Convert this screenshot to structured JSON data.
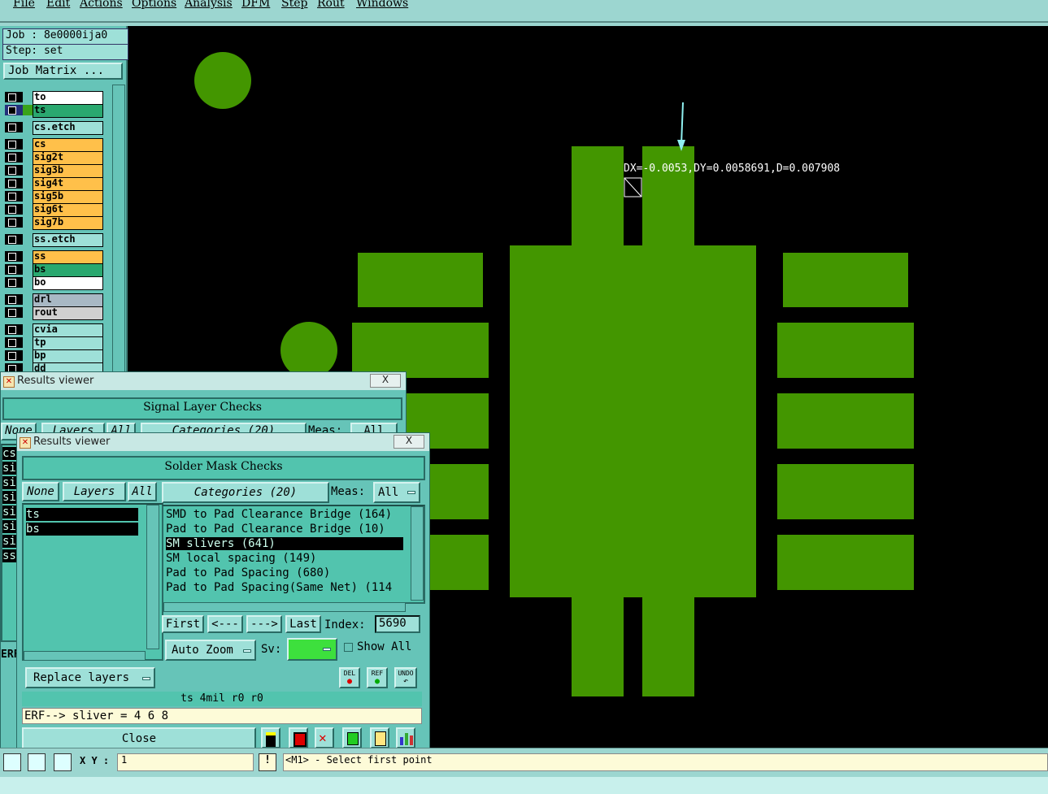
{
  "menubar": {
    "items": [
      "File",
      "Edit",
      "Actions",
      "Options",
      "Analysis",
      "DFM",
      "Step",
      "Rout",
      "Windows"
    ]
  },
  "job": {
    "job_label": "Job : 8e0000ija0",
    "step_label": "Step: set",
    "matrix_button": "Job Matrix ..."
  },
  "layers": [
    {
      "name": "to",
      "color": "#ffffff"
    },
    {
      "name": "ts",
      "color": "#2aa86f"
    },
    {
      "name": "cs.etch",
      "color": "#9ee0d8"
    },
    {
      "name": "cs",
      "color": "#ffc04a"
    },
    {
      "name": "sig2t",
      "color": "#ffc04a"
    },
    {
      "name": "sig3b",
      "color": "#ffc04a"
    },
    {
      "name": "sig4t",
      "color": "#ffc04a"
    },
    {
      "name": "sig5b",
      "color": "#ffc04a"
    },
    {
      "name": "sig6t",
      "color": "#ffc04a"
    },
    {
      "name": "sig7b",
      "color": "#ffc04a"
    },
    {
      "name": "ss.etch",
      "color": "#9ee0d8"
    },
    {
      "name": "ss",
      "color": "#ffc04a"
    },
    {
      "name": "bs",
      "color": "#2aa86f"
    },
    {
      "name": "bo",
      "color": "#ffffff"
    },
    {
      "name": "drl",
      "color": "#a8b8c4"
    },
    {
      "name": "rout",
      "color": "#d0d0d0"
    },
    {
      "name": "cvia",
      "color": "#9ee0d8"
    },
    {
      "name": "tp",
      "color": "#9ee0d8"
    },
    {
      "name": "bp",
      "color": "#9ee0d8"
    },
    {
      "name": "dd",
      "color": "#9ee0d8"
    }
  ],
  "canvas": {
    "measurement": "DX=-0.0053,DY=0.0058691,D=0.007908",
    "pad_color": "#439600"
  },
  "results_viewer_back": {
    "title": "Results viewer",
    "header": "Signal Layer Checks",
    "none_btn": "None",
    "layers_btn": "Layers",
    "all_btn": "All",
    "categories_btn": "Categories (20)",
    "meas_label": "Meas:",
    "meas_value": "All",
    "close_x": "X",
    "side_items": [
      "cs",
      "si",
      "si",
      "si",
      "si",
      "si",
      "si",
      "ss"
    ],
    "erf_label": "ERF"
  },
  "results_viewer_front": {
    "title": "Results viewer",
    "close_x": "X",
    "header": "Solder Mask Checks",
    "none_btn": "None",
    "layers_btn": "Layers",
    "all_btn": "All",
    "categories_btn": "Categories (20)",
    "meas_label": "Meas:",
    "meas_value": "All",
    "layers_list": [
      "ts",
      "bs"
    ],
    "categories_list": [
      "SMD to Pad Clearance Bridge (164)",
      "Pad to Pad Clearance Bridge (10)",
      "SM slivers (641)",
      "SM local spacing (149)",
      "Pad to Pad Spacing (680)",
      "Pad to Pad Spacing(Same Net) (114"
    ],
    "selected_category": 2,
    "nav": {
      "first": "First",
      "prev": "<---",
      "next": "--->",
      "last": "Last",
      "index_label": "Index:",
      "index_value": "5690"
    },
    "auto_zoom": "Auto Zoom",
    "sv_label": "Sv:",
    "show_all": "Show All",
    "replace_layers": "Replace layers",
    "del_label": "DEL",
    "ref_label": "REF",
    "undo_label": "UNDO",
    "status_line": "ts 4mil   r0   r0",
    "erf_line": "ERF--> sliver = 4 6 8",
    "close_btn": "Close"
  },
  "bottom_bar": {
    "xy_label": "X Y :",
    "xy_value": "1",
    "prompt": "<M1> - Select first point"
  }
}
